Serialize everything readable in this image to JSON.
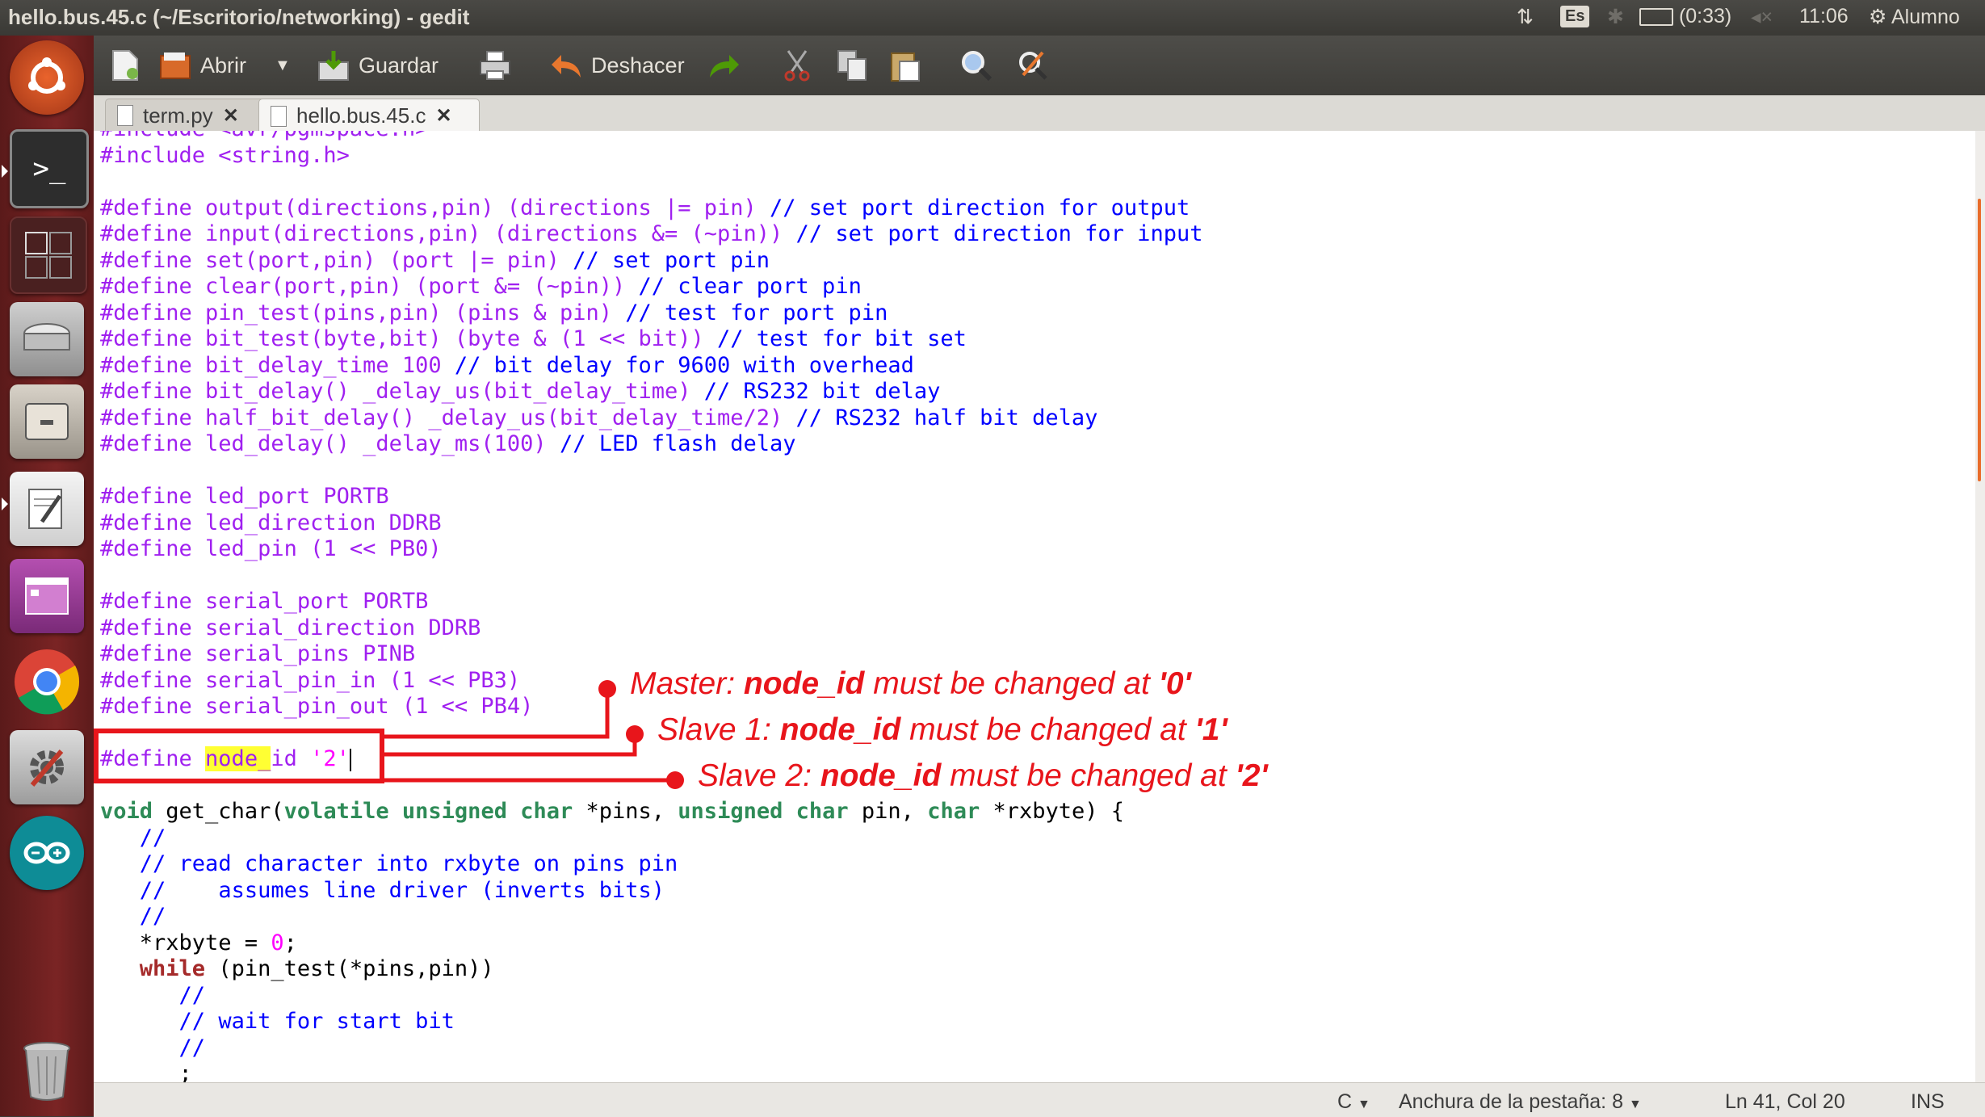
{
  "window": {
    "title": "hello.bus.45.c (~/Escritorio/networking) - gedit"
  },
  "panel": {
    "keyboard_layout": "Es",
    "battery": "(0:33)",
    "time": "11:06",
    "user": "Alumno"
  },
  "launcher": {
    "items": [
      "ubuntu-dash",
      "terminal",
      "workspace-switcher",
      "disk",
      "file-manager",
      "text-editor",
      "app-window",
      "chrome",
      "system-settings",
      "arduino",
      "trash"
    ]
  },
  "toolbar": {
    "open_label": "Abrir",
    "save_label": "Guardar",
    "undo_label": "Deshacer"
  },
  "tabs": [
    {
      "label": "term.py"
    },
    {
      "label": "hello.bus.45.c"
    }
  ],
  "code": {
    "lines": [
      "#include <avr/pgmspace.h>",
      "#include <string.h>",
      "",
      "#define output(directions,pin) (directions |= pin) // set port direction for output",
      "#define input(directions,pin) (directions &= (~pin)) // set port direction for input",
      "#define set(port,pin) (port |= pin) // set port pin",
      "#define clear(port,pin) (port &= (~pin)) // clear port pin",
      "#define pin_test(pins,pin) (pins & pin) // test for port pin",
      "#define bit_test(byte,bit) (byte & (1 << bit)) // test for bit set",
      "#define bit_delay_time 100 // bit delay for 9600 with overhead",
      "#define bit_delay() _delay_us(bit_delay_time) // RS232 bit delay",
      "#define half_bit_delay() _delay_us(bit_delay_time/2) // RS232 half bit delay",
      "#define led_delay() _delay_ms(100) // LED flash delay",
      "",
      "#define led_port PORTB",
      "#define led_direction DDRB",
      "#define led_pin (1 << PB0)",
      "",
      "#define serial_port PORTB",
      "#define serial_direction DDRB",
      "#define serial_pins PINB",
      "#define serial_pin_in (1 << PB3)",
      "#define serial_pin_out (1 << PB4)",
      "",
      "#define node_id '2'",
      "",
      "void get_char(volatile unsigned char *pins, unsigned char pin, char *rxbyte) {",
      "   //",
      "   // read character into rxbyte on pins pin",
      "   //    assumes line driver (inverts bits)",
      "   //",
      "   *rxbyte = 0;",
      "   while (pin_test(*pins,pin))",
      "      //",
      "      // wait for start bit",
      "      //",
      "      ;"
    ]
  },
  "statusbar": {
    "language": "C",
    "tab_width": "Anchura de la pestaña: 8",
    "position": "Ln 41, Col 20",
    "mode": "INS"
  },
  "annotations": {
    "master": {
      "prefix": "Master: ",
      "key": "node_id",
      "middle": " must be changed at ",
      "value": "'0'"
    },
    "slave1": {
      "prefix": "Slave 1: ",
      "key": "node_id",
      "middle": " must be changed at ",
      "value": "'1'"
    },
    "slave2": {
      "prefix": "Slave 2: ",
      "key": "node_id",
      "middle": " must be changed at ",
      "value": "'2'"
    },
    "color": "#e8151b"
  }
}
